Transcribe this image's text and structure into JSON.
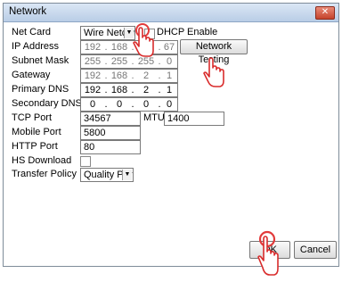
{
  "window": {
    "title": "Network",
    "close_label": "✕"
  },
  "net_card": {
    "label": "Net Card",
    "value": "Wire Netcard",
    "dhcp_label": "DHCP Enable"
  },
  "ip_address": {
    "label": "IP Address",
    "octets": [
      "192",
      "168",
      "2",
      "67"
    ],
    "test_button": "Network Testing"
  },
  "subnet_mask": {
    "label": "Subnet Mask",
    "octets": [
      "255",
      "255",
      "255",
      "0"
    ]
  },
  "gateway": {
    "label": "Gateway",
    "octets": [
      "192",
      "168",
      "2",
      "1"
    ]
  },
  "primary_dns": {
    "label": "Primary DNS",
    "octets": [
      "192",
      "168",
      "2",
      "1"
    ]
  },
  "secondary_dns": {
    "label": "Secondary DNS",
    "octets": [
      "0",
      "0",
      "0",
      "0"
    ]
  },
  "tcp_port": {
    "label": "TCP Port",
    "value": "34567",
    "mtu_label": "MTU",
    "mtu_value": "1400"
  },
  "mobile_port": {
    "label": "Mobile Port",
    "value": "5800"
  },
  "http_port": {
    "label": "HTTP Port",
    "value": "80"
  },
  "hs_download": {
    "label": "HS Download"
  },
  "transfer_policy": {
    "label": "Transfer Policy",
    "value": "Quality Prefer"
  },
  "actions": {
    "ok": "OK",
    "cancel": "Cancel"
  },
  "separator": "."
}
